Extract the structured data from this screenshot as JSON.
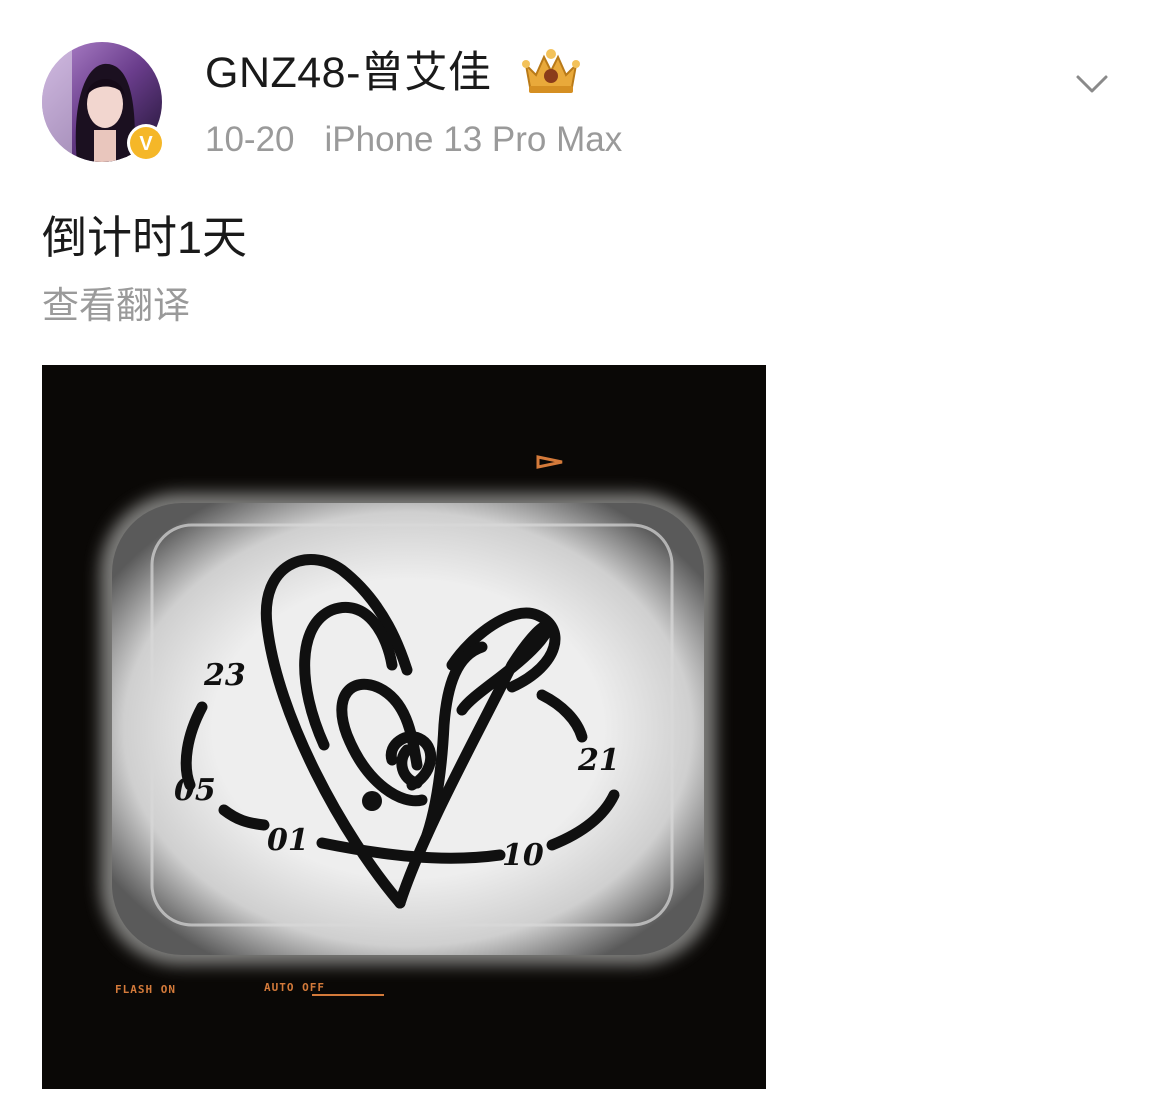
{
  "post": {
    "author_name": "GNZ48-曾艾佳",
    "verified_badge_letter": "V",
    "date": "10-20",
    "device": "iPhone 13 Pro Max",
    "text": "倒计时1天",
    "translate_label": "查看翻译"
  },
  "image": {
    "dates": [
      "23",
      "05",
      "01",
      "10",
      "21"
    ],
    "flash_label": "FLASH ON",
    "auto_label": "AUTO OFF"
  },
  "colors": {
    "text_primary": "#1a1a1a",
    "text_secondary": "#9a9a9a",
    "verified_badge": "#f5b728",
    "crown_gold": "#e9a93a"
  },
  "icons": {
    "menu": "chevron-down-icon",
    "badge": "verified-v-icon",
    "member": "crown-icon"
  }
}
